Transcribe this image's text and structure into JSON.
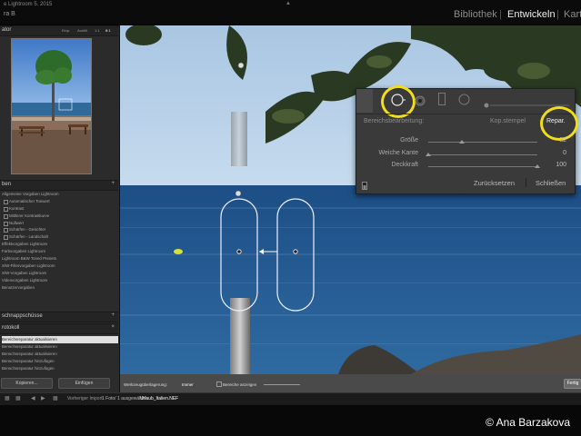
{
  "app": {
    "title": "e Lightroom 5. 2015",
    "subtitle": "ra B"
  },
  "modules": {
    "library": "Bibliothek",
    "develop": "Entwickeln",
    "map": "Kart"
  },
  "left_panel": {
    "navigator_title": "ator",
    "navigator_options": [
      "Einp.",
      "Ausfül.",
      "1:1",
      "8:1"
    ],
    "presets_title": "ben",
    "presets": [
      {
        "label": "Allgemeine Vorgaben Lightroom",
        "sub": false
      },
      {
        "label": "Automatischer Tonwert",
        "sub": true
      },
      {
        "label": "Kontrast",
        "sub": true
      },
      {
        "label": "Mittlerer Kontrastkurve",
        "sub": true
      },
      {
        "label": "Nullwert",
        "sub": true
      },
      {
        "label": "Schärfen - Gesichter",
        "sub": true
      },
      {
        "label": "Schärfen - Landschaft",
        "sub": true
      },
      {
        "label": "Effektvorgaben Lightroom",
        "sub": false
      },
      {
        "label": "Farbvorgaben Lightroom",
        "sub": false
      },
      {
        "label": "Lightroom B&W Toned Presets",
        "sub": false
      },
      {
        "label": "S/W-Filtervorgaben Lightroom",
        "sub": false
      },
      {
        "label": "S/W-Vorgaben Lightroom",
        "sub": false
      },
      {
        "label": "Videovorgaben Lightroom",
        "sub": false
      },
      {
        "label": "Benutzervorgaben",
        "sub": false
      }
    ],
    "snapshots_title": "schnappschüsse",
    "history_title": "rotokoll",
    "history": [
      {
        "label": "Bereichsreparatur aktualisieren",
        "selected": true
      },
      {
        "label": "Bereichsreparatur aktualisieren",
        "selected": false
      },
      {
        "label": "Bereichsreparatur aktualisieren",
        "selected": false
      },
      {
        "label": "Bereichsreparatur hinzufügen",
        "selected": false
      },
      {
        "label": "Bereichsreparatur hinzufügen",
        "selected": false
      }
    ],
    "copy_button": "Kopieren...",
    "paste_button": "Einfügen"
  },
  "toolbar": {
    "overlay_label": "Werkzeugüberlagerung:",
    "overlay_value": "Immer",
    "visualize_label": "Bereiche anzeigen",
    "done_button": "Fertig"
  },
  "filmstrip": {
    "source": "Vorheriger Import",
    "info": "1 Foto/ 1 ausgewählt /",
    "filename": "Urlaub_Italien.NEF",
    "credit": "© Ana Barzakova"
  },
  "spot_panel": {
    "area_label": "Bereichsbearbeitung:",
    "clone_label": "Kop.stempel",
    "heal_label": "Repar.",
    "sliders": [
      {
        "label": "Größe",
        "value": "32",
        "fraction": 0.31
      },
      {
        "label": "Weiche Kante",
        "value": "0",
        "fraction": 0.0
      },
      {
        "label": "Deckkraft",
        "value": "100",
        "fraction": 1.0
      }
    ],
    "reset_button": "Zurücksetzen",
    "close_button": "Schließen"
  },
  "colors": {
    "highlight": "#f2dd1a",
    "panel_bg": "#3a3a3a",
    "sea": "#2d5a8a"
  }
}
